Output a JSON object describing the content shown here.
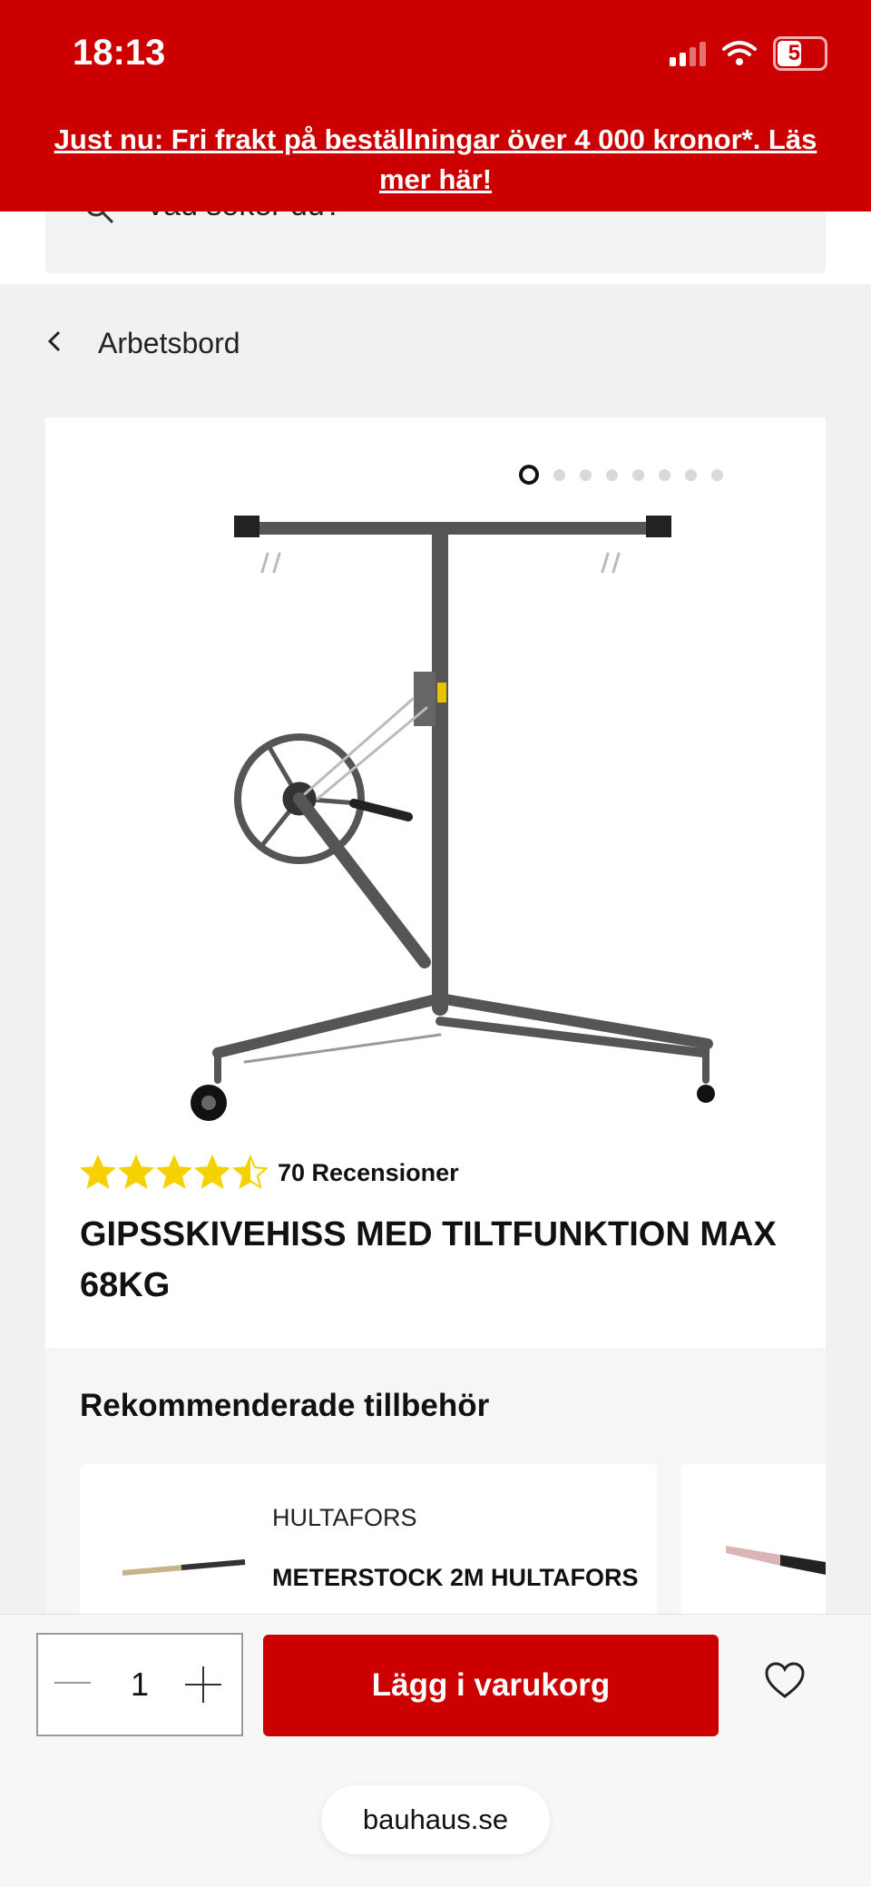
{
  "status_bar": {
    "time": "18:13",
    "battery": "55",
    "battery_level": 0.55
  },
  "promo_banner": {
    "text": "Just nu: Fri frakt på beställningar över 4 000 kronor*. Läs mer här!"
  },
  "search": {
    "placeholder": "Vad söker du?"
  },
  "breadcrumb": {
    "label": "Arbetsbord"
  },
  "gallery": {
    "image_count": 8,
    "active_index": 0
  },
  "product": {
    "rating_value": 4.5,
    "rating_max": 5,
    "reviews": "70 Recensioner",
    "title": "GIPSSKIVEHISS MED TILTFUNKTION MAX 68KG"
  },
  "recommended": {
    "title": "Rekommenderade tillbehör",
    "items": [
      {
        "brand": "HULTAFORS",
        "name": "METERSTOCK 2M HULTAFORS"
      }
    ]
  },
  "cart": {
    "quantity": "1",
    "add_label": "Lägg i varukorg"
  },
  "browser": {
    "url": "bauhaus.se"
  },
  "colors": {
    "brand_red": "#cc0000",
    "star_yellow": "#f5d100"
  }
}
